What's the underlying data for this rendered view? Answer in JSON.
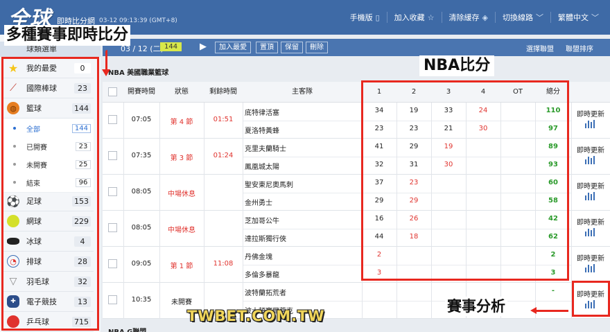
{
  "header": {
    "logo": "全球",
    "subtitle": "即時比分網",
    "timestamp": "03-12 09:13:39 (GMT+8)",
    "nav": [
      {
        "label": "手機版",
        "icon": "mobile-icon"
      },
      {
        "label": "加入收藏",
        "icon": "star-icon"
      },
      {
        "label": "清除緩存",
        "icon": "eraser-icon"
      },
      {
        "label": "切換線路",
        "icon": "chevron-down-icon"
      },
      {
        "label": "繁體中文",
        "icon": "chevron-down-icon"
      }
    ]
  },
  "sidebar": {
    "heading": "球類選單",
    "items": [
      {
        "label": "我的最愛",
        "count": "0",
        "icon": "star-icon",
        "color": "#f5c518"
      },
      {
        "label": "國際棒球",
        "count": "23",
        "icon": "baseball-bat-icon",
        "color": "#c0392b"
      },
      {
        "label": "籃球",
        "count": "144",
        "icon": "basketball-icon",
        "color": "#e67e22"
      }
    ],
    "subitems": [
      {
        "label": "全部",
        "count": "144",
        "active": true
      },
      {
        "label": "已開賽",
        "count": "23",
        "active": false
      },
      {
        "label": "未開賽",
        "count": "25",
        "active": false
      },
      {
        "label": "結束",
        "count": "96",
        "active": false
      }
    ],
    "items2": [
      {
        "label": "足球",
        "count": "153",
        "icon": "soccer-ball-icon",
        "color": "#222"
      },
      {
        "label": "網球",
        "count": "229",
        "icon": "tennis-ball-icon",
        "color": "#d4e02a"
      },
      {
        "label": "冰球",
        "count": "4",
        "icon": "hockey-puck-icon",
        "color": "#222"
      },
      {
        "label": "排球",
        "count": "28",
        "icon": "volleyball-icon",
        "color": "#3b6eb5"
      },
      {
        "label": "羽毛球",
        "count": "32",
        "icon": "shuttlecock-icon",
        "color": "#999"
      },
      {
        "label": "電子競技",
        "count": "13",
        "icon": "gamepad-icon",
        "color": "#2c4d8a"
      },
      {
        "label": "乒乓球",
        "count": "715",
        "icon": "ping-pong-icon",
        "color": "#e0332e"
      }
    ]
  },
  "toolbar": {
    "date": "03 / 12 (二)",
    "count": "144",
    "buttons": [
      "加入最愛",
      "置頂",
      "保留",
      "刪除"
    ],
    "right": [
      "選擇聯盟",
      "聯盟排序"
    ]
  },
  "league_title": "NBA 美國職業籃球",
  "league_title_2": "NBA G聯盟",
  "columns": {
    "start_time": "開賽時間",
    "status": "狀態",
    "remaining": "剩餘時間",
    "teams": "主客隊",
    "q1": "1",
    "q2": "2",
    "q3": "3",
    "q4": "4",
    "ot": "OT",
    "total": "總分"
  },
  "update_label": "即時更新",
  "games": [
    {
      "time": "07:05",
      "status": "第 4 節",
      "remaining": "01:51",
      "home": "底特律活塞",
      "away": "夏洛特黃蜂",
      "home_q": [
        "34",
        "19",
        "33",
        "24",
        ""
      ],
      "away_q": [
        "23",
        "23",
        "21",
        "30",
        ""
      ],
      "home_total": "110",
      "away_total": "97",
      "live_q": 3
    },
    {
      "time": "07:35",
      "status": "第 3 節",
      "remaining": "01:24",
      "home": "克里夫蘭騎士",
      "away": "鳳凰城太陽",
      "home_q": [
        "41",
        "29",
        "19",
        "",
        ""
      ],
      "away_q": [
        "32",
        "31",
        "30",
        "",
        ""
      ],
      "home_total": "89",
      "away_total": "93",
      "live_q": 2
    },
    {
      "time": "08:05",
      "status": "中場休息",
      "remaining": "",
      "home": "聖安東尼奧馬刺",
      "away": "金州勇士",
      "home_q": [
        "37",
        "23",
        "",
        "",
        ""
      ],
      "away_q": [
        "29",
        "29",
        "",
        "",
        ""
      ],
      "home_total": "60",
      "away_total": "58",
      "live_q": 1
    },
    {
      "time": "08:05",
      "status": "中場休息",
      "remaining": "",
      "home": "芝加哥公牛",
      "away": "達拉斯獨行俠",
      "home_q": [
        "16",
        "26",
        "",
        "",
        ""
      ],
      "away_q": [
        "44",
        "18",
        "",
        "",
        ""
      ],
      "home_total": "42",
      "away_total": "62",
      "live_q": 1
    },
    {
      "time": "09:05",
      "status": "第 1 節",
      "remaining": "11:08",
      "home": "丹佛金塊",
      "away": "多倫多暴龍",
      "home_q": [
        "2",
        "",
        "",
        "",
        ""
      ],
      "away_q": [
        "3",
        "",
        "",
        "",
        ""
      ],
      "home_total": "2",
      "away_total": "3",
      "live_q": 0
    },
    {
      "time": "10:35",
      "status": "未開賽",
      "remaining": "",
      "home": "波特蘭拓荒者",
      "away": "波士頓塞爾蒂克",
      "home_q": [
        "",
        "",
        "",
        "",
        ""
      ],
      "away_q": [
        "",
        "",
        "",
        "",
        ""
      ],
      "home_total": "-",
      "away_total": "",
      "live_q": -1
    }
  ],
  "annotations": {
    "sidebar_label": "多種賽事即時比分",
    "score_label": "NBA比分",
    "analysis_label": "賽事分析",
    "watermark": "TWBET.COM.TW"
  }
}
